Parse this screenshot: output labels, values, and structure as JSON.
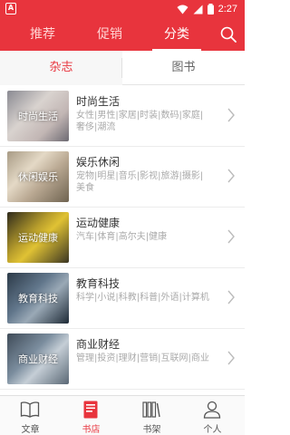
{
  "status_bar": {
    "time": "2:27"
  },
  "top_tabs": [
    {
      "label": "推荐",
      "active": false
    },
    {
      "label": "促销",
      "active": false
    },
    {
      "label": "分类",
      "active": true
    }
  ],
  "segments": [
    {
      "label": "杂志",
      "active": true
    },
    {
      "label": "图书",
      "active": false
    }
  ],
  "categories": [
    {
      "thumb_label": "时尚生活",
      "title": "时尚生活",
      "tags": "女性|男性|家居|时装|数码|家庭|奢侈|潮流"
    },
    {
      "thumb_label": "休闲娱乐",
      "title": "娱乐休闲",
      "tags": "宠物|明星|音乐|影视|旅游|摄影|美食"
    },
    {
      "thumb_label": "运动健康",
      "title": "运动健康",
      "tags": "汽车|体育|高尔夫|健康"
    },
    {
      "thumb_label": "教育科技",
      "title": "教育科技",
      "tags": "科学|小说|科教|科普|外语|计算机"
    },
    {
      "thumb_label": "商业财经",
      "title": "商业财经",
      "tags": "管理|投资|理财|营销|互联网|商业"
    }
  ],
  "bottom_nav": [
    {
      "label": "文章",
      "icon": "book-open-icon",
      "active": false
    },
    {
      "label": "书店",
      "icon": "bookstore-icon",
      "active": true
    },
    {
      "label": "书架",
      "icon": "bookshelf-icon",
      "active": false
    },
    {
      "label": "个人",
      "icon": "person-icon",
      "active": false
    }
  ],
  "colors": {
    "accent": "#e8343d"
  }
}
